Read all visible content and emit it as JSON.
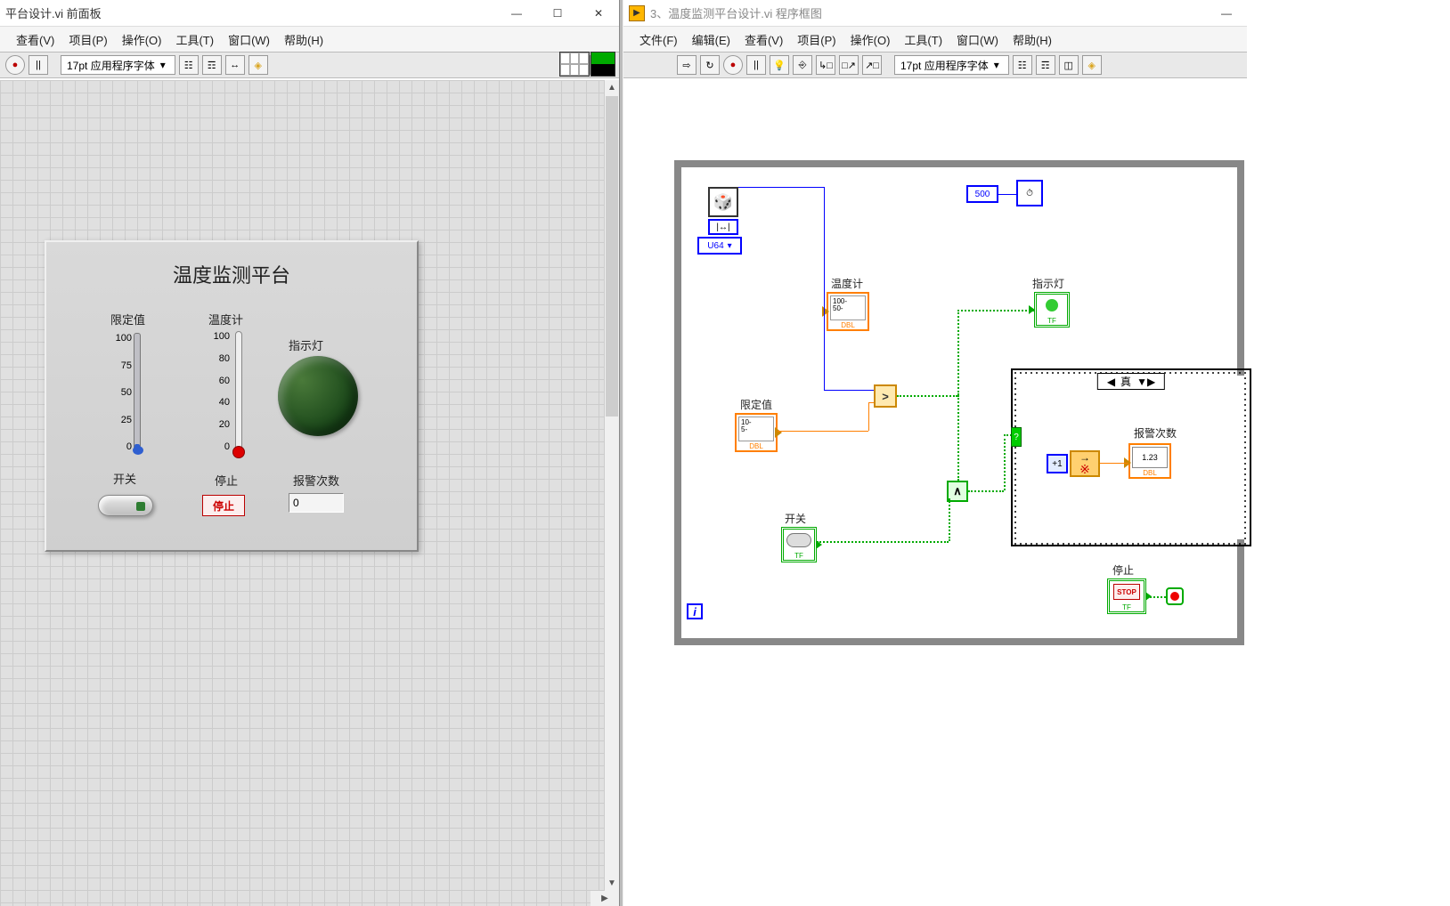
{
  "left_window": {
    "title": "平台设计.vi 前面板",
    "win_buttons": {
      "min": "—",
      "max": "☐",
      "close": "✕"
    },
    "menu": [
      "查看(V)",
      "项目(P)",
      "操作(O)",
      "工具(T)",
      "窗口(W)",
      "帮助(H)"
    ],
    "toolbar": {
      "run_circle": "●",
      "pause": "||",
      "font": "17pt 应用程序字体",
      "search_icon": "🔍",
      "help_icon": "?"
    }
  },
  "right_window": {
    "title": "3、温度监测平台设计.vi 程序框图",
    "win_buttons": {
      "min": "—"
    },
    "menu": [
      "文件(F)",
      "编辑(E)",
      "查看(V)",
      "项目(P)",
      "操作(O)",
      "工具(T)",
      "窗口(W)",
      "帮助(H)"
    ],
    "toolbar": {
      "font": "17pt 应用程序字体"
    }
  },
  "panel": {
    "title": "温度监测平台",
    "limit_label": "限定值",
    "thermo_label": "温度计",
    "led_label": "指示灯",
    "switch_label": "开关",
    "stop_label": "停止",
    "stop_button": "停止",
    "alarm_count_label": "报警次数",
    "alarm_count_value": "0",
    "limit_ticks": {
      "t0": "100",
      "t1": "75",
      "t2": "50",
      "t3": "25",
      "t4": "0"
    },
    "thermo_ticks": {
      "t0": "100",
      "t1": "80",
      "t2": "60",
      "t3": "40",
      "t4": "20",
      "t5": "0"
    }
  },
  "diagram": {
    "dice": "🎲",
    "dice_sub": "|↔|",
    "u64": "U64",
    "wait_const": "500",
    "thermo_label": "温度计",
    "thermo_node": "100-\n50-",
    "thermo_type": "DBL",
    "limit_label": "限定值",
    "limit_node": "10-\n5-",
    "limit_type": "DBL",
    "switch_label": "开关",
    "switch_type": "TF",
    "led_label": "指示灯",
    "led_type": "TF",
    "case_true": "真",
    "alarm_label": "报警次数",
    "alarm_node": "1.23",
    "alarm_type": "DBL",
    "plus1": "+1",
    "star": "※",
    "compare": ">",
    "and": "∧",
    "stop_label": "停止",
    "stop_node": "STOP",
    "stop_type": "TF",
    "loop_i": "i",
    "question": "?"
  }
}
